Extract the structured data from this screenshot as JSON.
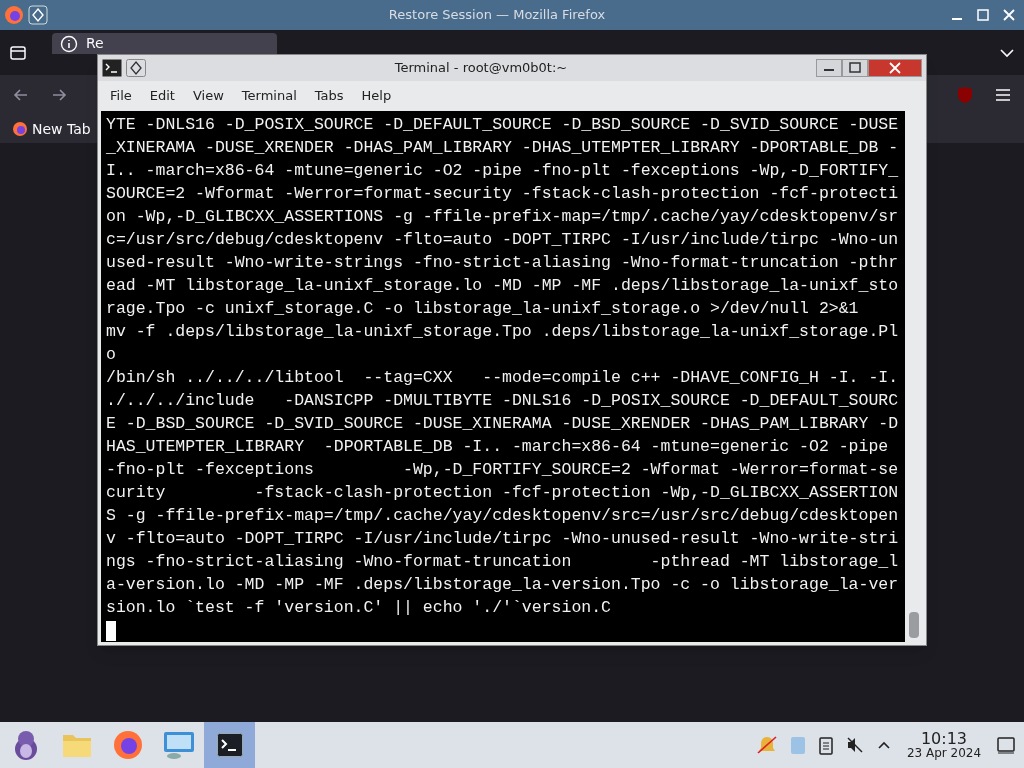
{
  "browser": {
    "title": "Restore Session — Mozilla Firefox",
    "tab": {
      "label": "Re",
      "selected": true
    },
    "bookmark": "New Tab"
  },
  "terminal": {
    "title": "Terminal - root@vm0b0t:~",
    "menu": [
      "File",
      "Edit",
      "View",
      "Terminal",
      "Tabs",
      "Help"
    ],
    "lines": [
      "YTE -DNLS16 -D_POSIX_SOURCE -D_DEFAULT_SOURCE -D_BSD_SOURCE -D_SVID_SOURCE -DUSE",
      "_XINERAMA -DUSE_XRENDER -DHAS_PAM_LIBRARY -DHAS_UTEMPTER_LIBRARY -DPORTABLE_DB -",
      "I.. -march=x86-64 -mtune=generic -O2 -pipe -fno-plt -fexceptions -Wp,-D_FORTIFY_",
      "SOURCE=2 -Wformat -Werror=format-security -fstack-clash-protection -fcf-protecti",
      "on -Wp,-D_GLIBCXX_ASSERTIONS -g -ffile-prefix-map=/tmp/.cache/yay/cdesktopenv/sr",
      "c=/usr/src/debug/cdesktopenv -flto=auto -DOPT_TIRPC -I/usr/include/tirpc -Wno-un",
      "used-result -Wno-write-strings -fno-strict-aliasing -Wno-format-truncation -pthr",
      "ead -MT libstorage_la-unixf_storage.lo -MD -MP -MF .deps/libstorage_la-unixf_sto",
      "rage.Tpo -c unixf_storage.C -o libstorage_la-unixf_storage.o >/dev/null 2>&1",
      "mv -f .deps/libstorage_la-unixf_storage.Tpo .deps/libstorage_la-unixf_storage.Pl",
      "o",
      "/bin/sh ../../../libtool  --tag=CXX   --mode=compile c++ -DHAVE_CONFIG_H -I. -I.",
      "./../../include   -DANSICPP -DMULTIBYTE -DNLS16 -D_POSIX_SOURCE -D_DEFAULT_SOURC",
      "E -D_BSD_SOURCE -D_SVID_SOURCE -DUSE_XINERAMA -DUSE_XRENDER -DHAS_PAM_LIBRARY -D",
      "HAS_UTEMPTER_LIBRARY  -DPORTABLE_DB -I.. -march=x86-64 -mtune=generic -O2 -pipe",
      "-fno-plt -fexceptions         -Wp,-D_FORTIFY_SOURCE=2 -Wformat -Werror=format-se",
      "curity         -fstack-clash-protection -fcf-protection -Wp,-D_GLIBCXX_ASSERTION",
      "S -g -ffile-prefix-map=/tmp/.cache/yay/cdesktopenv/src=/usr/src/debug/cdesktopen",
      "v -flto=auto -DOPT_TIRPC -I/usr/include/tirpc -Wno-unused-result -Wno-write-stri",
      "ngs -fno-strict-aliasing -Wno-format-truncation        -pthread -MT libstorage_l",
      "a-version.lo -MD -MP -MF .deps/libstorage_la-version.Tpo -c -o libstorage_la-ver",
      "sion.lo `test -f 'version.C' || echo './'`version.C"
    ]
  },
  "taskbar": {
    "apps": [
      {
        "kind": "mascot",
        "selected": false
      },
      {
        "kind": "folder",
        "selected": false
      },
      {
        "kind": "browser",
        "selected": false
      },
      {
        "kind": "monitor",
        "selected": false
      },
      {
        "kind": "terminal",
        "selected": true
      }
    ],
    "time": "10:13",
    "date": "23 Apr 2024"
  }
}
